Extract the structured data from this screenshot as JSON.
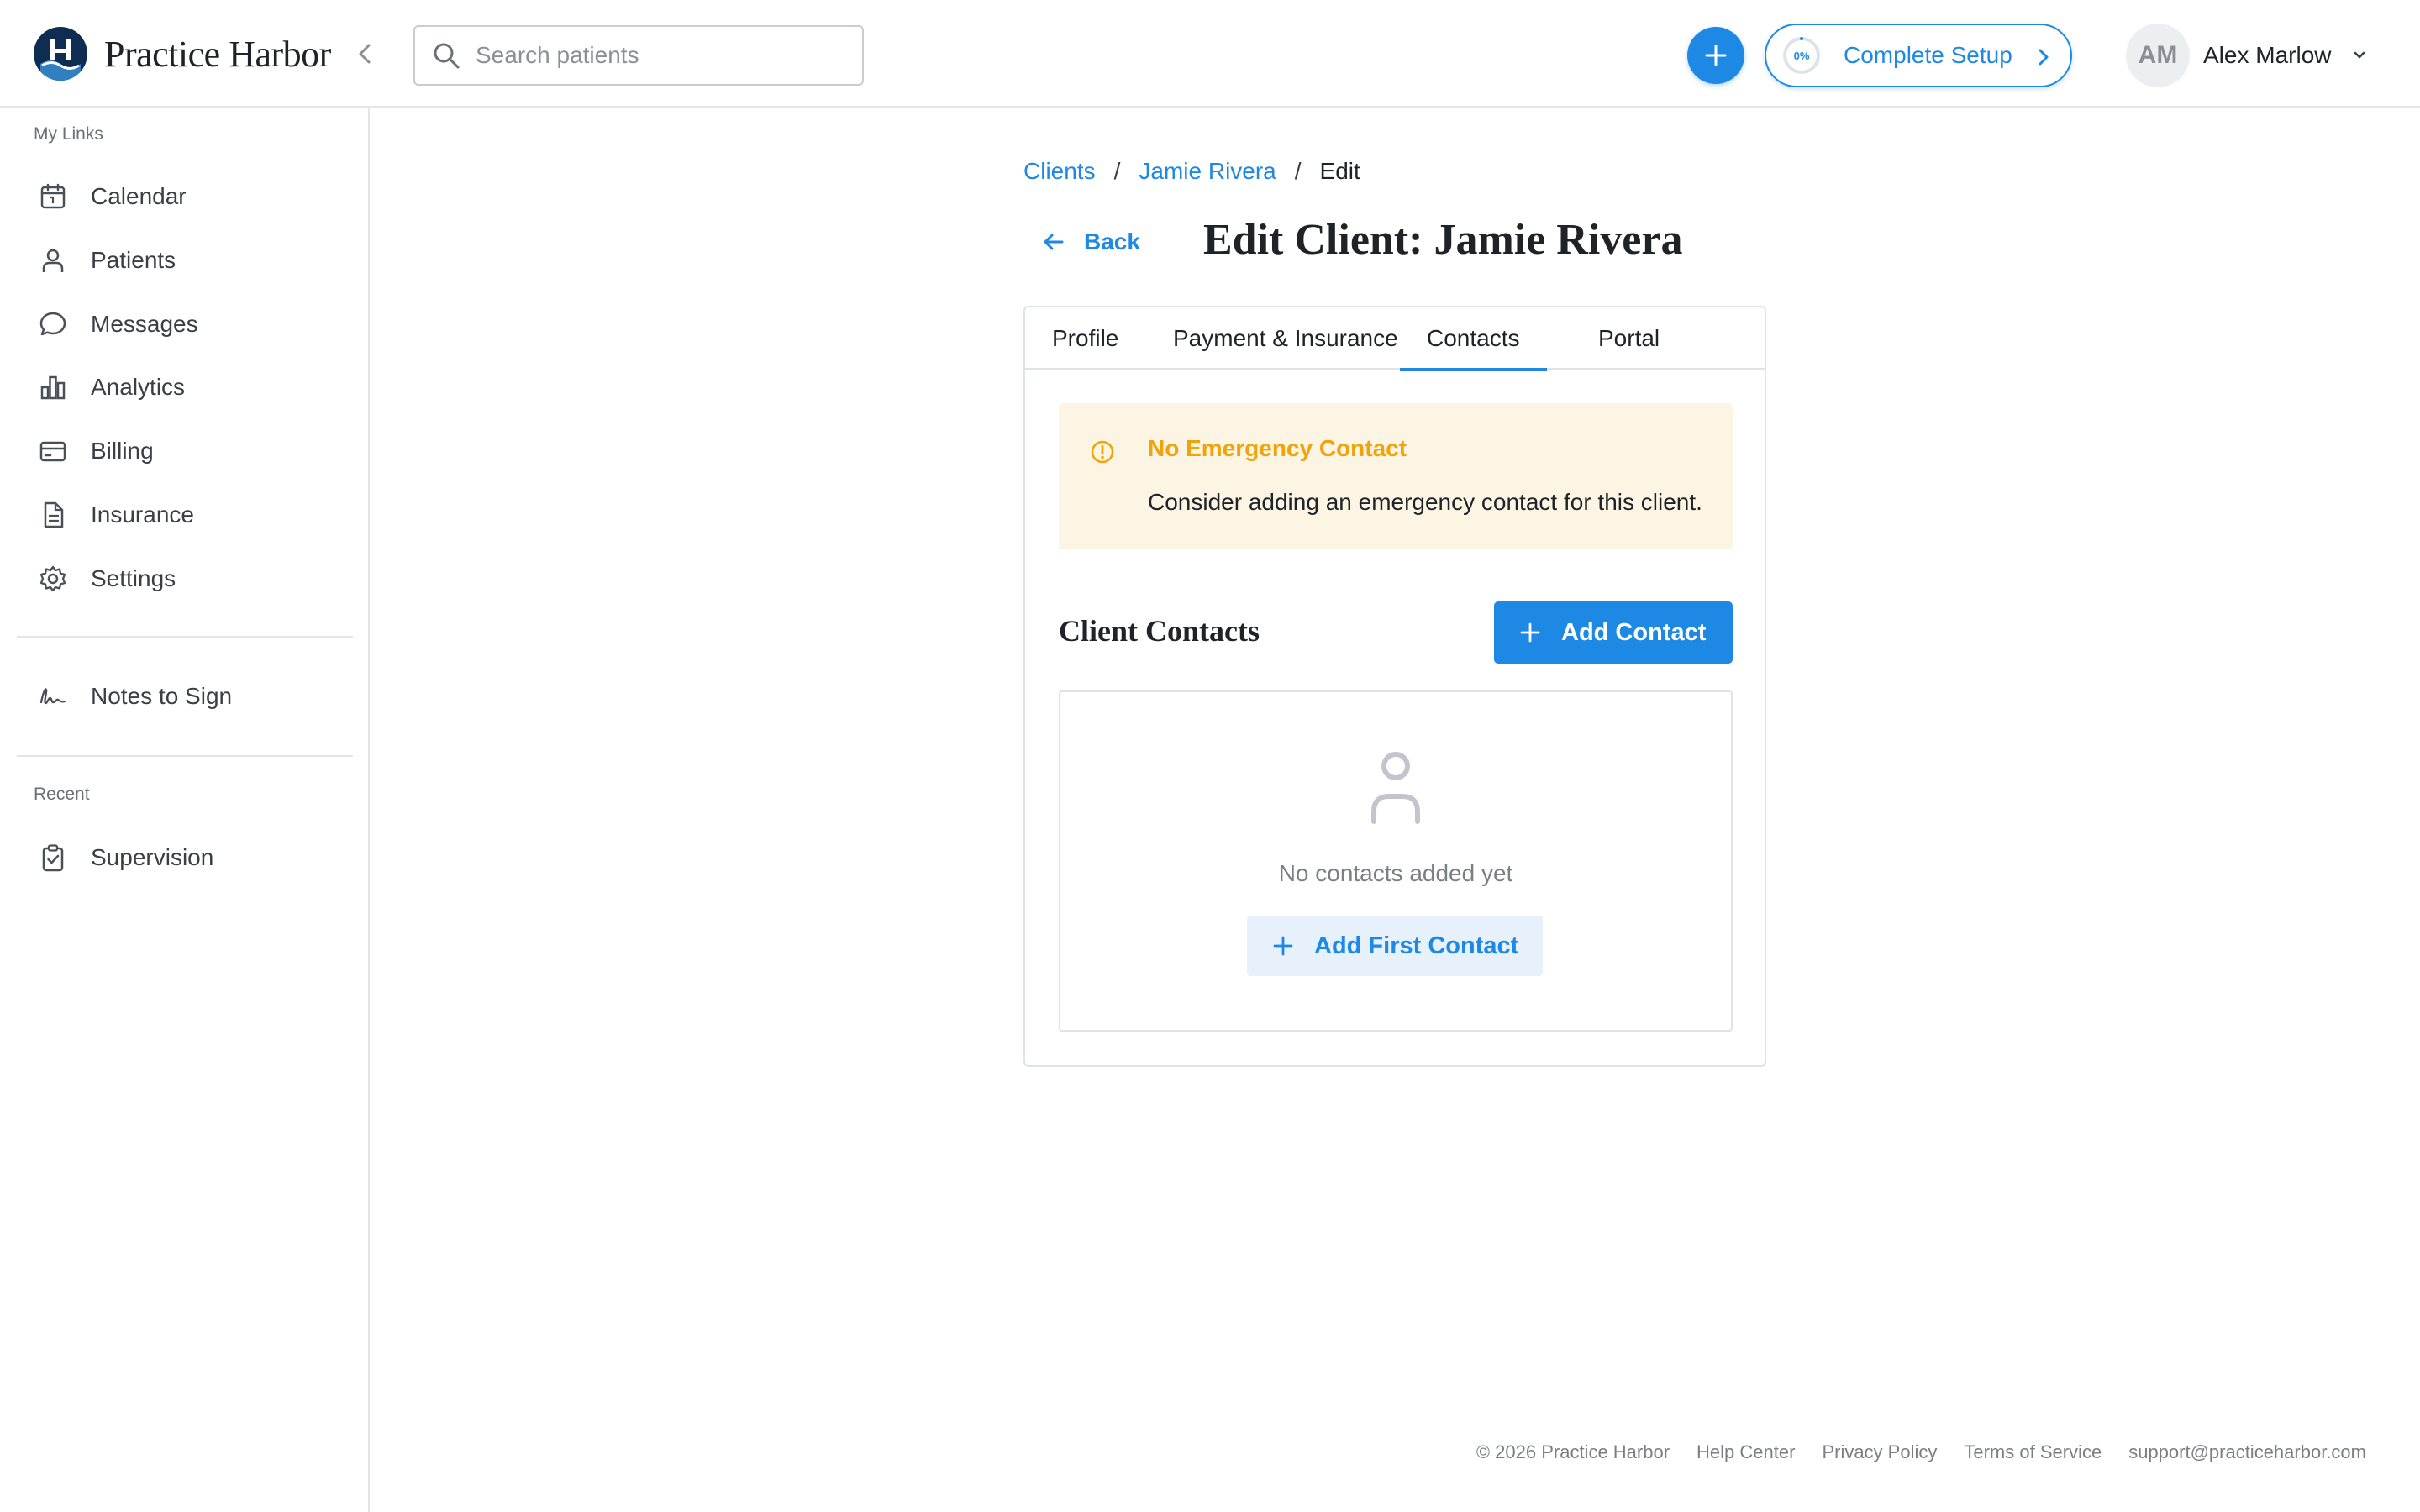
{
  "app": {
    "name": "Practice Harbor"
  },
  "header": {
    "search_placeholder": "Search patients",
    "setup": {
      "progress": "0%",
      "label": "Complete Setup"
    },
    "user": {
      "initials": "AM",
      "name": "Alex Marlow"
    }
  },
  "sidebar": {
    "my_links_label": "My Links",
    "items": [
      {
        "label": "Calendar",
        "icon": "calendar-icon"
      },
      {
        "label": "Patients",
        "icon": "person-icon"
      },
      {
        "label": "Messages",
        "icon": "message-icon"
      },
      {
        "label": "Analytics",
        "icon": "bar-chart-icon"
      },
      {
        "label": "Billing",
        "icon": "credit-card-icon"
      },
      {
        "label": "Insurance",
        "icon": "document-icon"
      },
      {
        "label": "Settings",
        "icon": "gear-icon"
      }
    ],
    "notes_to_sign": "Notes to Sign",
    "recent_label": "Recent",
    "recent_items": [
      {
        "label": "Supervision",
        "icon": "clipboard-check-icon"
      }
    ]
  },
  "breadcrumb": {
    "root": "Clients",
    "client": "Jamie Rivera",
    "current": "Edit",
    "separator": "/"
  },
  "page": {
    "back_label": "Back",
    "title": "Edit Client: Jamie Rivera"
  },
  "tabs": [
    {
      "label": "Profile",
      "active": false
    },
    {
      "label": "Payment & Insurance",
      "active": false
    },
    {
      "label": "Contacts",
      "active": true
    },
    {
      "label": "Portal",
      "active": false
    }
  ],
  "alert": {
    "title": "No Emergency Contact",
    "body": "Consider adding an emergency contact for this client."
  },
  "contacts": {
    "title": "Client Contacts",
    "add_button": "Add Contact",
    "empty_text": "No contacts added yet",
    "add_first_button": "Add First Contact"
  },
  "footer": {
    "copyright": "© 2026 Practice Harbor",
    "links": [
      "Help Center",
      "Privacy Policy",
      "Terms of Service"
    ],
    "email": "support@practiceharbor.com"
  },
  "colors": {
    "accent": "#1e88e5",
    "brand_navy": "#0f2d52",
    "warning": "#f0a30a",
    "warning_bg": "#fdf5e4"
  }
}
